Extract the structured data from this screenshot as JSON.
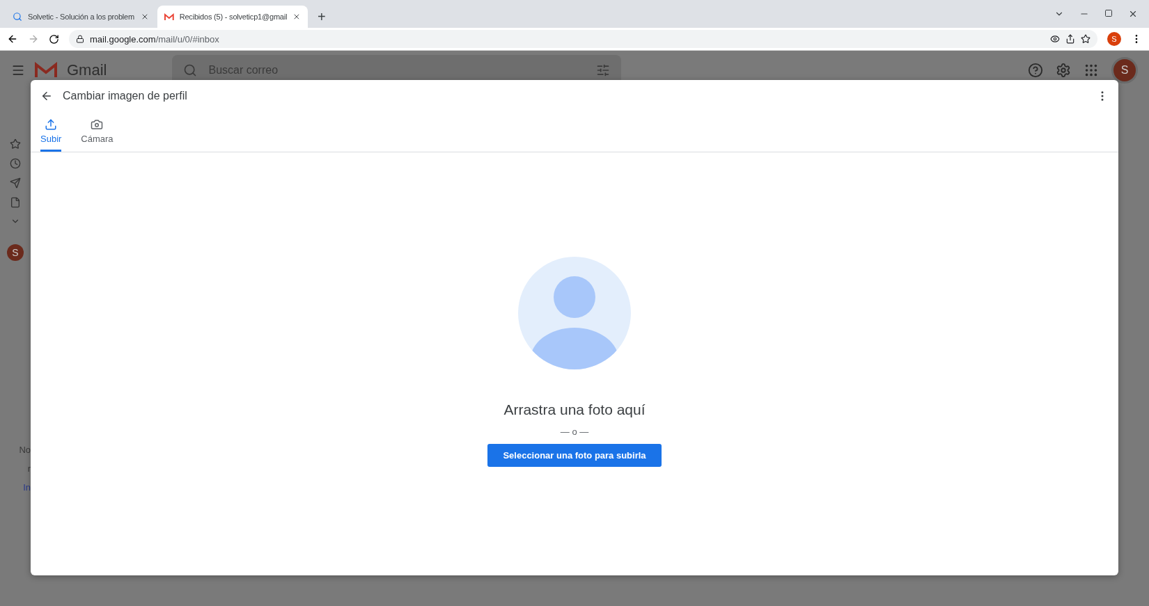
{
  "browser": {
    "tabs": [
      {
        "title": "Solvetic - Solución a los problem",
        "selected": false,
        "kind": "solvetic"
      },
      {
        "title": "Recibidos (5) - solveticp1@gmail",
        "selected": true,
        "kind": "gmail"
      }
    ],
    "new_tab": "+",
    "url_host": "mail.google.com",
    "url_path": "/mail/u/0/#inbox",
    "profile": "S"
  },
  "gmail": {
    "brand": "Gmail",
    "search_placeholder": "Buscar correo",
    "account": "S",
    "sidebar_avatar": "S",
    "sidebar_fragments": [
      "No",
      "r",
      "In"
    ]
  },
  "dialog": {
    "title": "Cambiar imagen de perfil",
    "tabs": [
      {
        "label": "Subir",
        "selected": true,
        "kind": "upload"
      },
      {
        "label": "Cámara",
        "selected": false,
        "kind": "camera"
      }
    ],
    "heading": "Arrastra una foto aquí",
    "separator": "— o —",
    "button": "Seleccionar una foto para subirla"
  }
}
